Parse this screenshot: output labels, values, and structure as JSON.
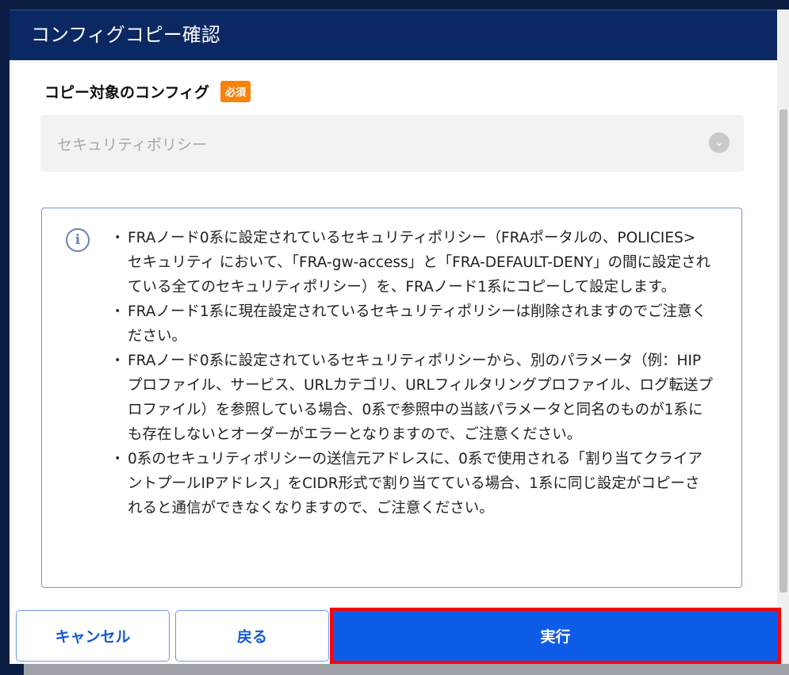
{
  "dialog": {
    "title": "コンフィグコピー確認",
    "field_label": "コピー対象のコンフィグ",
    "required_badge": "必須",
    "select_value": "セキュリティポリシー",
    "notes": [
      "FRAノード0系に設定されているセキュリティポリシー（FRAポータルの、POLICIES> セキュリティ において、「FRA-gw-access」と「FRA-DEFAULT-DENY」の間に設定されている全てのセキュリティポリシー）を、FRAノード1系にコピーして設定します。",
      "FRAノード1系に現在設定されているセキュリティポリシーは削除されますのでご注意ください。",
      "FRAノード0系に設定されているセキュリティポリシーから、別のパラメータ（例：HIPプロファイル、サービス、URLカテゴリ、URLフィルタリングプロファイル、ログ転送プロファイル）を参照している場合、0系で参照中の当該パラメータと同名のものが1系にも存在しないとオーダーがエラーとなりますので、ご注意ください。",
      "0系のセキュリティポリシーの送信元アドレスに、0系で使用される「割り当てクライアントプールIPアドレス」をCIDR形式で割り当てている場合、1系に同じ設定がコピーされると通信ができなくなりますので、ご注意ください。"
    ],
    "buttons": {
      "cancel": "キャンセル",
      "back": "戻る",
      "execute": "実行"
    }
  },
  "colors": {
    "header": "#0b2862",
    "primary": "#0d5ce8",
    "badge": "#f98209",
    "highlight": "#ff0000"
  }
}
